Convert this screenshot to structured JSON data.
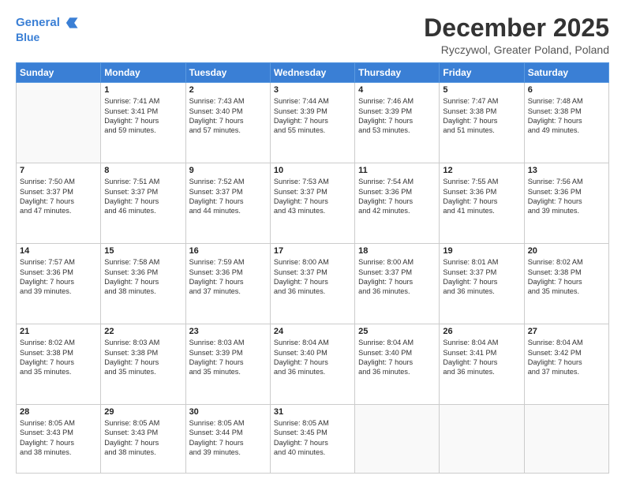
{
  "header": {
    "logo_line1": "General",
    "logo_line2": "Blue",
    "title": "December 2025",
    "subtitle": "Ryczywol, Greater Poland, Poland"
  },
  "days_of_week": [
    "Sunday",
    "Monday",
    "Tuesday",
    "Wednesday",
    "Thursday",
    "Friday",
    "Saturday"
  ],
  "weeks": [
    [
      {
        "day": "",
        "info": ""
      },
      {
        "day": "1",
        "info": "Sunrise: 7:41 AM\nSunset: 3:41 PM\nDaylight: 7 hours\nand 59 minutes."
      },
      {
        "day": "2",
        "info": "Sunrise: 7:43 AM\nSunset: 3:40 PM\nDaylight: 7 hours\nand 57 minutes."
      },
      {
        "day": "3",
        "info": "Sunrise: 7:44 AM\nSunset: 3:39 PM\nDaylight: 7 hours\nand 55 minutes."
      },
      {
        "day": "4",
        "info": "Sunrise: 7:46 AM\nSunset: 3:39 PM\nDaylight: 7 hours\nand 53 minutes."
      },
      {
        "day": "5",
        "info": "Sunrise: 7:47 AM\nSunset: 3:38 PM\nDaylight: 7 hours\nand 51 minutes."
      },
      {
        "day": "6",
        "info": "Sunrise: 7:48 AM\nSunset: 3:38 PM\nDaylight: 7 hours\nand 49 minutes."
      }
    ],
    [
      {
        "day": "7",
        "info": "Sunrise: 7:50 AM\nSunset: 3:37 PM\nDaylight: 7 hours\nand 47 minutes."
      },
      {
        "day": "8",
        "info": "Sunrise: 7:51 AM\nSunset: 3:37 PM\nDaylight: 7 hours\nand 46 minutes."
      },
      {
        "day": "9",
        "info": "Sunrise: 7:52 AM\nSunset: 3:37 PM\nDaylight: 7 hours\nand 44 minutes."
      },
      {
        "day": "10",
        "info": "Sunrise: 7:53 AM\nSunset: 3:37 PM\nDaylight: 7 hours\nand 43 minutes."
      },
      {
        "day": "11",
        "info": "Sunrise: 7:54 AM\nSunset: 3:36 PM\nDaylight: 7 hours\nand 42 minutes."
      },
      {
        "day": "12",
        "info": "Sunrise: 7:55 AM\nSunset: 3:36 PM\nDaylight: 7 hours\nand 41 minutes."
      },
      {
        "day": "13",
        "info": "Sunrise: 7:56 AM\nSunset: 3:36 PM\nDaylight: 7 hours\nand 39 minutes."
      }
    ],
    [
      {
        "day": "14",
        "info": "Sunrise: 7:57 AM\nSunset: 3:36 PM\nDaylight: 7 hours\nand 39 minutes."
      },
      {
        "day": "15",
        "info": "Sunrise: 7:58 AM\nSunset: 3:36 PM\nDaylight: 7 hours\nand 38 minutes."
      },
      {
        "day": "16",
        "info": "Sunrise: 7:59 AM\nSunset: 3:36 PM\nDaylight: 7 hours\nand 37 minutes."
      },
      {
        "day": "17",
        "info": "Sunrise: 8:00 AM\nSunset: 3:37 PM\nDaylight: 7 hours\nand 36 minutes."
      },
      {
        "day": "18",
        "info": "Sunrise: 8:00 AM\nSunset: 3:37 PM\nDaylight: 7 hours\nand 36 minutes."
      },
      {
        "day": "19",
        "info": "Sunrise: 8:01 AM\nSunset: 3:37 PM\nDaylight: 7 hours\nand 36 minutes."
      },
      {
        "day": "20",
        "info": "Sunrise: 8:02 AM\nSunset: 3:38 PM\nDaylight: 7 hours\nand 35 minutes."
      }
    ],
    [
      {
        "day": "21",
        "info": "Sunrise: 8:02 AM\nSunset: 3:38 PM\nDaylight: 7 hours\nand 35 minutes."
      },
      {
        "day": "22",
        "info": "Sunrise: 8:03 AM\nSunset: 3:38 PM\nDaylight: 7 hours\nand 35 minutes."
      },
      {
        "day": "23",
        "info": "Sunrise: 8:03 AM\nSunset: 3:39 PM\nDaylight: 7 hours\nand 35 minutes."
      },
      {
        "day": "24",
        "info": "Sunrise: 8:04 AM\nSunset: 3:40 PM\nDaylight: 7 hours\nand 36 minutes."
      },
      {
        "day": "25",
        "info": "Sunrise: 8:04 AM\nSunset: 3:40 PM\nDaylight: 7 hours\nand 36 minutes."
      },
      {
        "day": "26",
        "info": "Sunrise: 8:04 AM\nSunset: 3:41 PM\nDaylight: 7 hours\nand 36 minutes."
      },
      {
        "day": "27",
        "info": "Sunrise: 8:04 AM\nSunset: 3:42 PM\nDaylight: 7 hours\nand 37 minutes."
      }
    ],
    [
      {
        "day": "28",
        "info": "Sunrise: 8:05 AM\nSunset: 3:43 PM\nDaylight: 7 hours\nand 38 minutes."
      },
      {
        "day": "29",
        "info": "Sunrise: 8:05 AM\nSunset: 3:43 PM\nDaylight: 7 hours\nand 38 minutes."
      },
      {
        "day": "30",
        "info": "Sunrise: 8:05 AM\nSunset: 3:44 PM\nDaylight: 7 hours\nand 39 minutes."
      },
      {
        "day": "31",
        "info": "Sunrise: 8:05 AM\nSunset: 3:45 PM\nDaylight: 7 hours\nand 40 minutes."
      },
      {
        "day": "",
        "info": ""
      },
      {
        "day": "",
        "info": ""
      },
      {
        "day": "",
        "info": ""
      }
    ]
  ]
}
